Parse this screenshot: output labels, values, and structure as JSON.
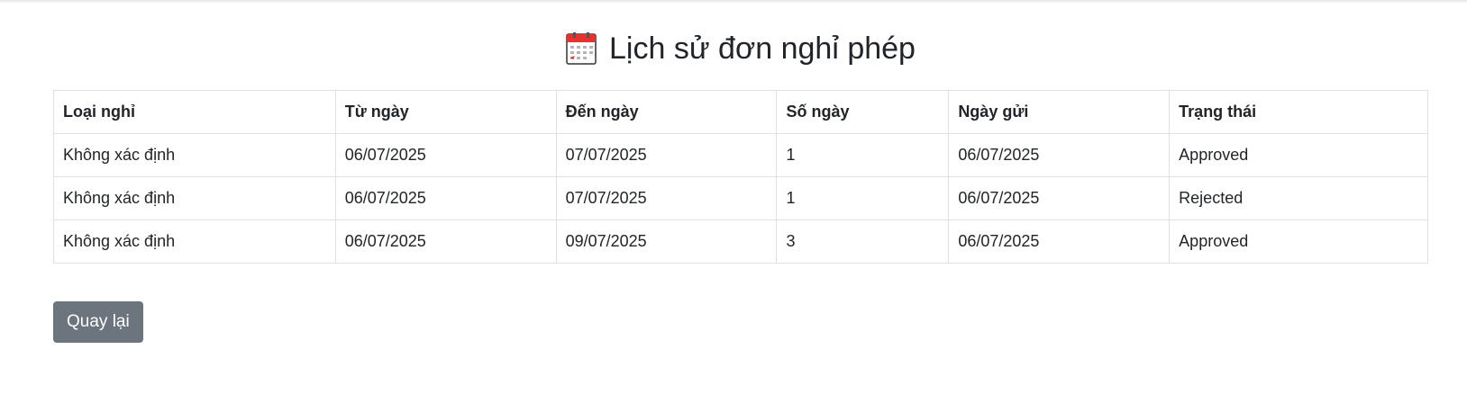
{
  "page": {
    "title": "Lịch sử đơn nghỉ phép",
    "title_icon": "calendar-icon"
  },
  "table": {
    "headers": [
      "Loại nghỉ",
      "Từ ngày",
      "Đến ngày",
      "Số ngày",
      "Ngày gửi",
      "Trạng thái"
    ],
    "rows": [
      [
        "Không xác định",
        "06/07/2025",
        "07/07/2025",
        "1",
        "06/07/2025",
        "Approved"
      ],
      [
        "Không xác định",
        "06/07/2025",
        "07/07/2025",
        "1",
        "06/07/2025",
        "Rejected"
      ],
      [
        "Không xác định",
        "06/07/2025",
        "09/07/2025",
        "3",
        "06/07/2025",
        "Approved"
      ]
    ]
  },
  "actions": {
    "back_label": "Quay lại"
  },
  "colors": {
    "button_bg": "#6c757d",
    "border": "#dee2e6",
    "calendar_red": "#e3342f"
  }
}
